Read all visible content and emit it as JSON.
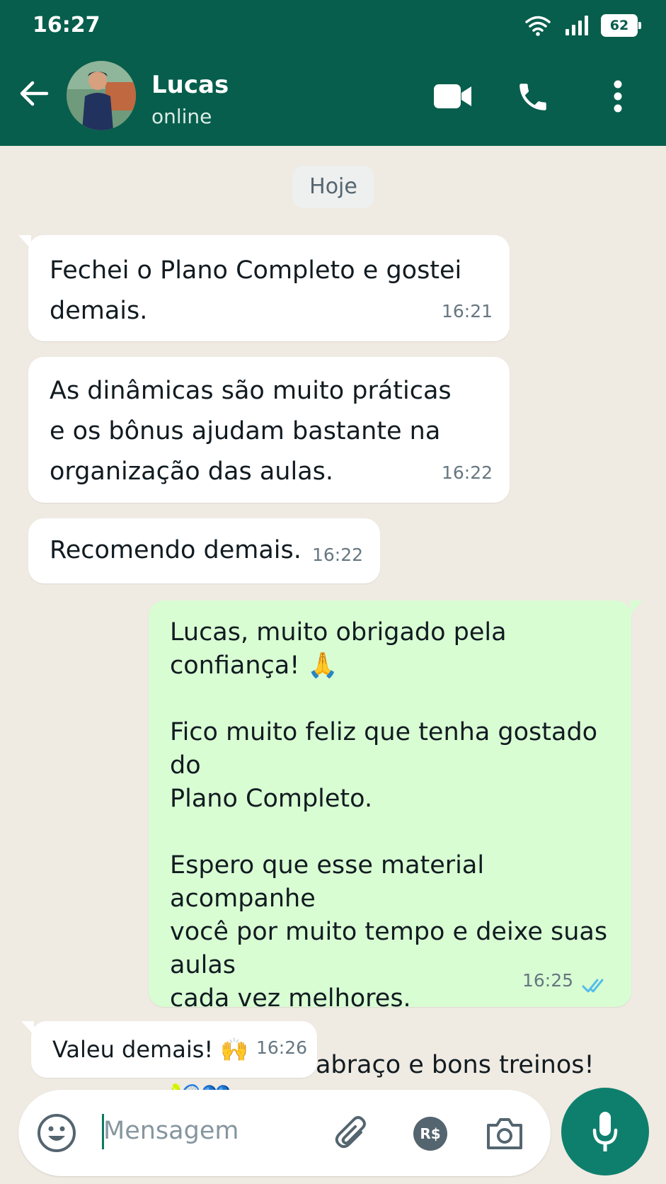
{
  "status_bar": {
    "time": "16:27",
    "battery": "62"
  },
  "header": {
    "contact_name": "Lucas",
    "contact_status": "online"
  },
  "chat": {
    "date_divider": "Hoje",
    "messages": [
      {
        "direction": "in",
        "text": "Fechei o Plano Completo e gostei\ndemais.",
        "time": "16:21"
      },
      {
        "direction": "in",
        "text": "As dinâmicas são muito práticas\ne os bônus ajudam bastante na\norganização das aulas.",
        "time": "16:22"
      },
      {
        "direction": "in",
        "text": "Recomendo demais.",
        "time": "16:22"
      },
      {
        "direction": "out",
        "text": "Lucas, muito obrigado pela confiança! 🙏\n\nFico muito feliz que tenha gostado do\nPlano Completo.\n\nEspero que esse material acompanhe\nvocê por muito tempo e deixe suas aulas\ncada vez melhores.\n\nUm grande abraço e bons treinos!\n🎾💙",
        "time": "16:25",
        "status": "read"
      },
      {
        "direction": "in",
        "text": "Valeu demais! 🙌",
        "time": "16:26"
      }
    ]
  },
  "composer": {
    "placeholder": "Mensagem",
    "currency_label": "R$"
  },
  "icons": {
    "back": "arrow-left-icon",
    "video": "video-call-icon",
    "phone": "phone-icon",
    "menu": "more-vertical-icon",
    "emoji": "emoji-icon",
    "attach": "paperclip-icon",
    "payment": "payment-icon",
    "camera": "camera-icon",
    "mic": "microphone-icon"
  },
  "colors": {
    "header": "#075e4c",
    "outgoing_bubble": "#d9fdd3",
    "incoming_bubble": "#ffffff",
    "chat_bg": "#efeae2",
    "mic_button": "#0e7f6d",
    "read_ticks": "#53bdeb"
  }
}
